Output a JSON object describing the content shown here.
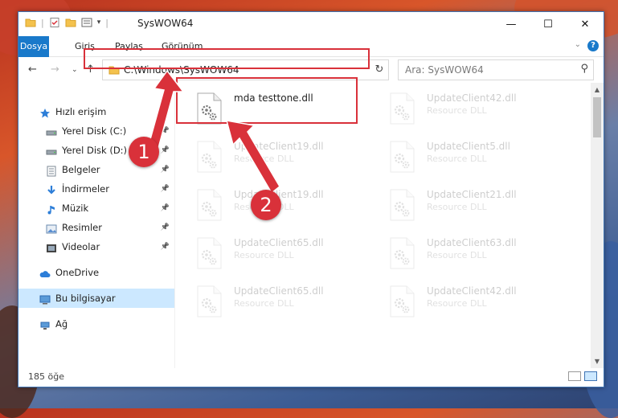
{
  "window": {
    "title": "SysWOW64"
  },
  "ribbon": {
    "file_tab": "Dosya",
    "tabs": [
      "Giriş",
      "Paylaş",
      "Görünüm"
    ],
    "help": "?"
  },
  "address": {
    "path": "C:\\Windows\\SysWOW64",
    "search_placeholder": "Ara: SysWOW64"
  },
  "sidebar": {
    "items": [
      {
        "label": "Hızlı erişim",
        "icon": "star-icon",
        "indent": false,
        "pinned": false
      },
      {
        "label": "Yerel Disk (C:)",
        "icon": "drive-icon",
        "indent": true,
        "pinned": true
      },
      {
        "label": "Yerel Disk (D:)",
        "icon": "drive-icon",
        "indent": true,
        "pinned": true
      },
      {
        "label": "Belgeler",
        "icon": "documents-icon",
        "indent": true,
        "pinned": true
      },
      {
        "label": "İndirmeler",
        "icon": "download-icon",
        "indent": true,
        "pinned": true
      },
      {
        "label": "Müzik",
        "icon": "music-icon",
        "indent": true,
        "pinned": true
      },
      {
        "label": "Resimler",
        "icon": "pictures-icon",
        "indent": true,
        "pinned": true
      },
      {
        "label": "Videolar",
        "icon": "videos-icon",
        "indent": true,
        "pinned": true
      },
      {
        "label": "OneDrive",
        "icon": "cloud-icon",
        "indent": false,
        "pinned": false
      },
      {
        "label": "Bu bilgisayar",
        "icon": "computer-icon",
        "indent": false,
        "pinned": false,
        "selected": true
      },
      {
        "label": "Ağ",
        "icon": "network-icon",
        "indent": false,
        "pinned": false
      }
    ]
  },
  "files": [
    {
      "name": "mda testtone.dll",
      "type": "",
      "highlighted": true
    },
    {
      "name": "UpdateClient42.dll",
      "type": "Resource DLL"
    },
    {
      "name": "UpdateClient19.dll",
      "type": "Resource DLL"
    },
    {
      "name": "UpdateClient5.dll",
      "type": "Resource DLL"
    },
    {
      "name": "UpdateClient19.dll",
      "type": "Resource DLL"
    },
    {
      "name": "UpdateClient21.dll",
      "type": "Resource DLL"
    },
    {
      "name": "UpdateClient65.dll",
      "type": "Resource DLL"
    },
    {
      "name": "UpdateClient63.dll",
      "type": "Resource DLL"
    },
    {
      "name": "UpdateClient65.dll",
      "type": "Resource DLL"
    },
    {
      "name": "UpdateClient42.dll",
      "type": "Resource DLL"
    }
  ],
  "status": {
    "count": "185 öğe"
  },
  "annotations": {
    "step1": "1",
    "step2": "2"
  },
  "colors": {
    "accent": "#1979ca",
    "highlight": "#d9313a",
    "selected": "#cce8ff"
  }
}
